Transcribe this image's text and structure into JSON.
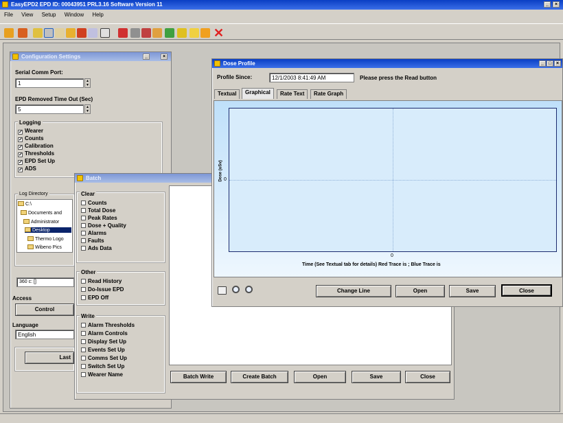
{
  "app": {
    "title": "EasyEPD2 EPD ID: 00043951 PRL3.16 Software Version 11",
    "menu": [
      "File",
      "View",
      "Setup",
      "Window",
      "Help"
    ],
    "controls": [
      "_",
      "□",
      "×"
    ]
  },
  "settings_window": {
    "title": "Configuration Settings",
    "serial_comm_port_label": "Serial Comm Port:",
    "serial_comm_port_value": "1",
    "epd_removed_timeout_label": "EPD Removed Time Out (Sec)",
    "epd_removed_timeout_value": "5",
    "logging_label": "Logging",
    "logging_items": [
      "Wearer",
      "Counts",
      "Calibration",
      "Thresholds",
      "EPD Set Up",
      "ADS"
    ],
    "log_directory_label": "Log Directory",
    "tree": [
      "C:\\",
      "Documents and",
      "Administrator",
      "Desktop",
      "Thermo Logo",
      "Wibeno Pics"
    ],
    "drive_value": "360 c: []",
    "access_label": "Access",
    "control_label": "Control",
    "language_label": "Language",
    "language_value": "English",
    "last_button": "Last"
  },
  "batch_window": {
    "title": "Batch",
    "clear_label": "Clear",
    "clear_items": [
      "Counts",
      "Total Dose",
      "Peak Rates",
      "Dose + Quality",
      "Alarms",
      "Faults",
      "Ads Data"
    ],
    "other_label": "Other",
    "other_items": [
      "Read History",
      "Do-Issue EPD",
      "EPD Off"
    ],
    "write_label": "Write",
    "write_items": [
      "Alarm Thresholds",
      "Alarm Controls",
      "Display Set Up",
      "Events Set Up",
      "Comms Set Up",
      "Switch Set Up",
      "Wearer Name"
    ],
    "buttons": [
      "Batch Write",
      "Create Batch",
      "Open",
      "Save",
      "Close"
    ]
  },
  "dose_window": {
    "title": "Dose Profile",
    "profile_since_label": "Profile Since:",
    "profile_since_value": "12/1/2003 8:41:49 AM",
    "hint": "Please press the Read button",
    "tabs": [
      "Textual",
      "Graphical",
      "Rate Text",
      "Rate Graph"
    ],
    "active_tab": 1,
    "y_axis_label": "Dose (uSv)",
    "y_tick": "0",
    "x_tick": "0",
    "x_axis_label": "Time (See Textual tab for details) Red Trace is ; Blue Trace is",
    "buttons": [
      "Change Line",
      "Open",
      "Save",
      "Close"
    ]
  },
  "colors": {
    "title_active": "#0a3fc4",
    "plot_bg": "#d8ecfb",
    "plot_border": "#1a2a6e"
  }
}
